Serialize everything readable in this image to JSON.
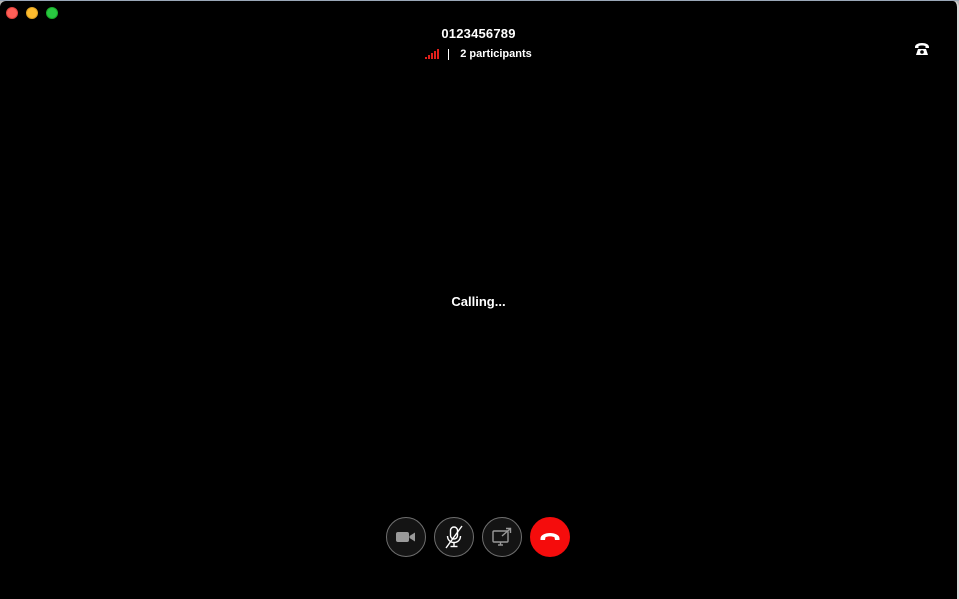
{
  "window": {
    "controls": [
      "close",
      "minimize",
      "maximize"
    ]
  },
  "call": {
    "number": "0123456789",
    "participants": "2 participants",
    "status": "Calling...",
    "signal_icon": "signal-bars-icon",
    "signal_color": "#e0201b"
  },
  "toolbar": {
    "buttons": [
      {
        "name": "video",
        "icon": "video-camera-icon"
      },
      {
        "name": "mute",
        "icon": "microphone-muted-icon"
      },
      {
        "name": "share-screen",
        "icon": "share-screen-icon"
      },
      {
        "name": "end-call",
        "icon": "hang-up-icon",
        "color": "#f50c0c"
      }
    ]
  },
  "top_right": {
    "icon": "telephone-icon"
  }
}
